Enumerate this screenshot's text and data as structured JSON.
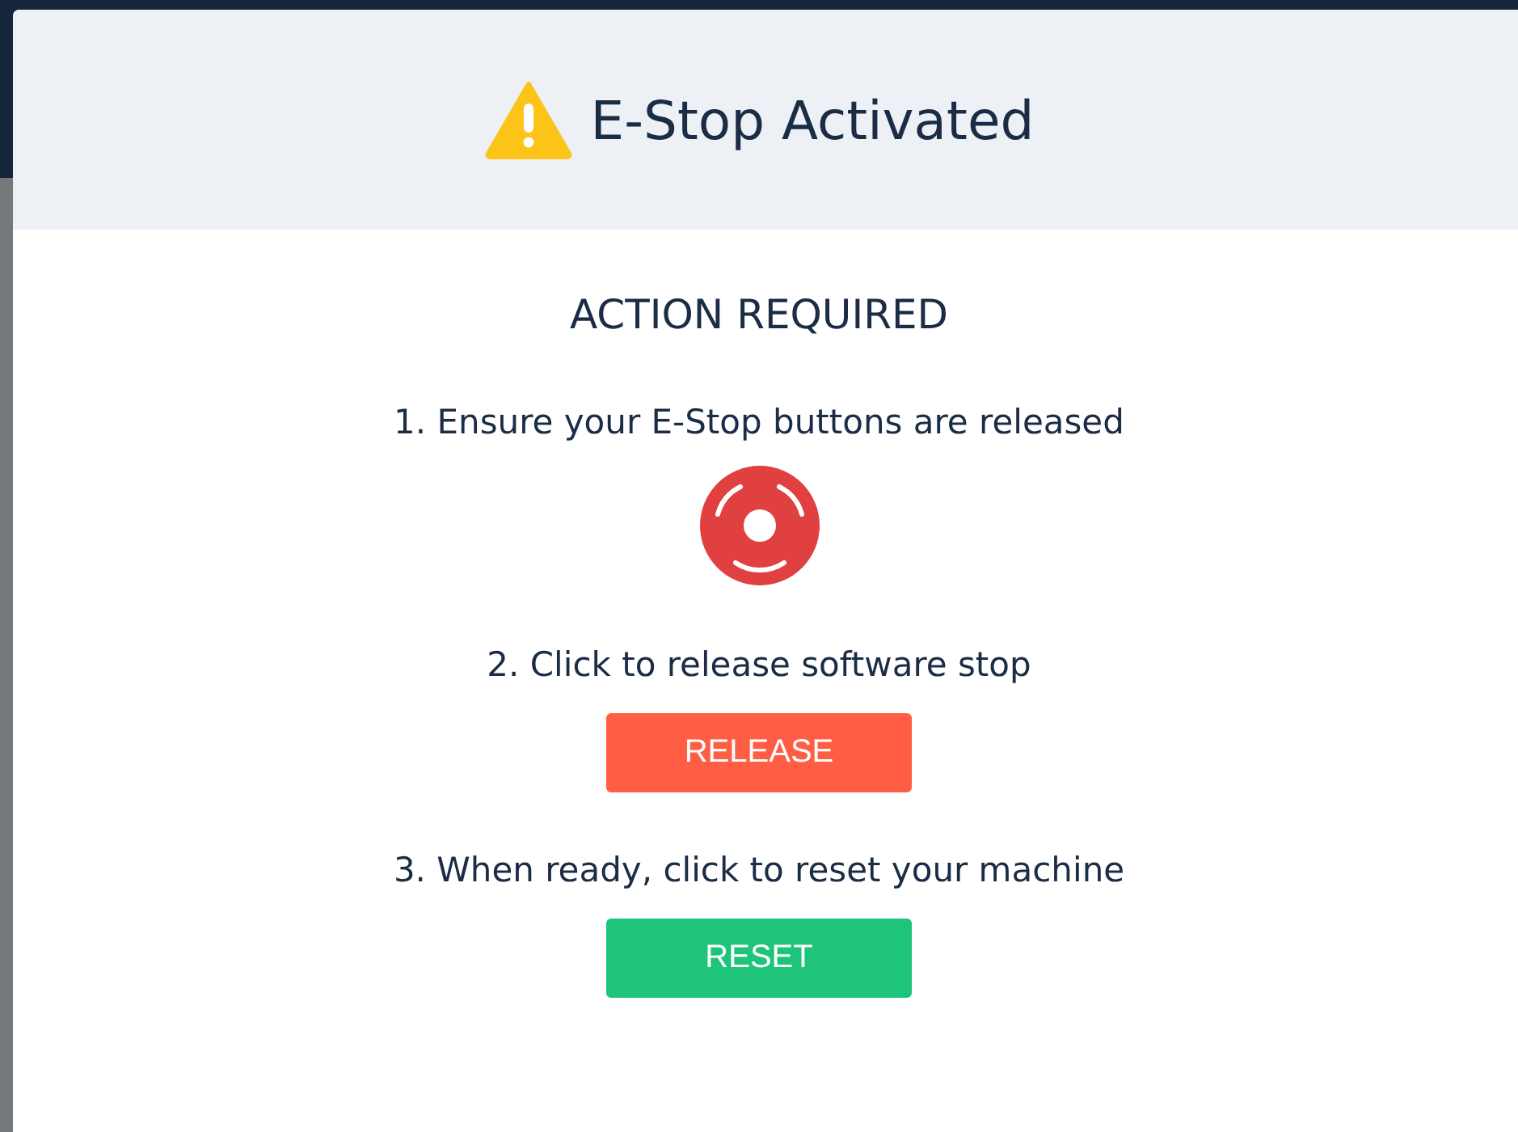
{
  "dialog": {
    "title": "E-Stop Activated",
    "heading": "ACTION REQUIRED",
    "steps": [
      {
        "text": "1. Ensure your E-Stop buttons are released",
        "kind": "estop"
      },
      {
        "text": "2. Click to release software stop",
        "kind": "button",
        "button": {
          "label": "RELEASE",
          "color": "#ff5e45"
        }
      },
      {
        "text": "3. When ready, click to reset your machine",
        "kind": "button",
        "button": {
          "label": "RESET",
          "color": "#1ec47a"
        }
      }
    ]
  }
}
